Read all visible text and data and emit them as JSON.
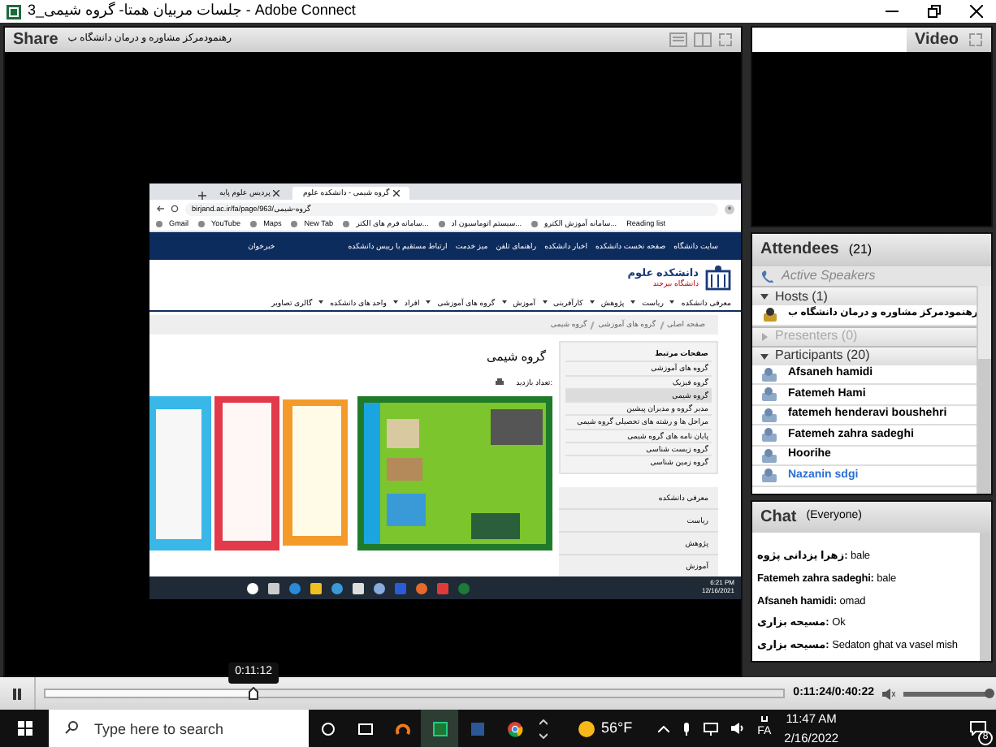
{
  "window": {
    "title": "جلسات مربیان همتا- گروه شیمی_3 - Adobe Connect"
  },
  "share_pod": {
    "title": "Share",
    "presenter": "رهنمودمرکز مشاوره و درمان دانشگاه ب",
    "shared_screen": {
      "browser_tabs": [
        {
          "label": "گروه شیمی - دانشکده علوم",
          "selected": true
        },
        {
          "label": "پردیس علوم پایه",
          "selected": false
        }
      ],
      "address": "birjand.ac.ir/fa/page/963/گروه-شیمی",
      "reading_list": "Reading list",
      "bookmarks": [
        "سامانه آموزش الکترو...",
        "سیستم اتوماسیون اد...",
        "سامانه فرم های الکتر...",
        "New Tab",
        "Maps",
        "YouTube",
        "Gmail"
      ],
      "top_links": [
        "سایت دانشگاه",
        "صفحه نخست دانشکده",
        "اخبار دانشکده",
        "راهنمای تلفن",
        "میز خدمت",
        "ارتباط مستقیم با رییس دانشکده"
      ],
      "news_feed": "خبرخوان",
      "logo": {
        "name": "دانشکده علوم",
        "university": "دانشگاه بیرجند"
      },
      "nav": [
        {
          "label": "معرفی دانشکده",
          "dropdown": true
        },
        {
          "label": "ریاست",
          "dropdown": true
        },
        {
          "label": "پژوهش",
          "dropdown": true
        },
        {
          "label": "کارآفرینی",
          "dropdown": true
        },
        {
          "label": "آموزش",
          "dropdown": true
        },
        {
          "label": "گروه های آموزشی",
          "dropdown": true
        },
        {
          "label": "افراد",
          "dropdown": true
        },
        {
          "label": "واحد های دانشکده",
          "dropdown": true
        },
        {
          "label": "گالری تصاویر",
          "dropdown": false
        }
      ],
      "breadcrumb": [
        "صفحه اصلی",
        "گروه های آموزشی",
        "گروه شیمی"
      ],
      "page_title": "گروه شیمی",
      "visits": "تعداد بازدید:",
      "related_title": "صفحات مرتبط",
      "related": [
        {
          "label": "گروه های آموزشی",
          "selected": false
        },
        {
          "label": "گروه فیزیک",
          "selected": false
        },
        {
          "label": "گروه شیمی",
          "selected": true
        },
        {
          "label": "مدیر گروه و مدیران پیشین",
          "selected": false
        },
        {
          "label": "مراحل ها و رشته های تحصیلی گروه شیمی",
          "selected": false
        },
        {
          "label": "پایان نامه های گروه شیمی",
          "selected": false
        },
        {
          "label": "گروه زیست شناسی",
          "selected": false
        },
        {
          "label": "گروه زمین شناسی",
          "selected": false
        }
      ],
      "menu": [
        "معرفی دانشکده",
        "ریاست",
        "پژوهش",
        "آموزش"
      ],
      "taskbar": {
        "time": "6:21 PM",
        "date": "12/16/2021"
      }
    }
  },
  "video_pod": {
    "title": "Video"
  },
  "attendees": {
    "title": "Attendees",
    "count": "(21)",
    "active_speakers": "Active Speakers",
    "groups": [
      {
        "label": "Hosts (1)",
        "expanded": true,
        "members": [
          {
            "name": "رهنمودمرکز مشاوره و درمان دانشگاه ب",
            "kind": "host",
            "color": "#000000"
          }
        ]
      },
      {
        "label": "Presenters (0)",
        "expanded": false
      },
      {
        "label": "Participants (20)",
        "expanded": true,
        "members": [
          {
            "name": "Afsaneh hamidi",
            "kind": "participant",
            "color": "#000000"
          },
          {
            "name": "Fatemeh Hami",
            "kind": "participant",
            "color": "#000000"
          },
          {
            "name": "fatemeh henderavi boushehri",
            "kind": "participant",
            "color": "#000000"
          },
          {
            "name": "Fatemeh zahra sadeghi",
            "kind": "participant",
            "color": "#000000"
          },
          {
            "name": "Hoorihe",
            "kind": "participant",
            "color": "#000000"
          },
          {
            "name": "Nazanin sdgi",
            "kind": "participant",
            "color": "#2a6fd6"
          }
        ]
      }
    ]
  },
  "chat": {
    "title": "Chat",
    "scope": "(Everyone)",
    "messages": [
      "**زهرا یزدانی پژوه:** bale",
      "**Fatemeh zahra sadeghi:** bale",
      "**Afsaneh hamidi:** omad",
      "**مسیحه بزاری:** Ok",
      "**مسیحه بزاری:** Sedaton ghat va vasel mish"
    ]
  },
  "playback": {
    "tooltip": "0:11:12",
    "level": 0.282,
    "time": "0:11:24/0:40:22",
    "volume": {
      "level": 1
    }
  },
  "taskbar": {
    "search_placeholder": "Type here to search",
    "weather": "56°F",
    "language": "FA",
    "time": "11:47 AM",
    "date": "2/16/2022",
    "notifications": "8"
  }
}
